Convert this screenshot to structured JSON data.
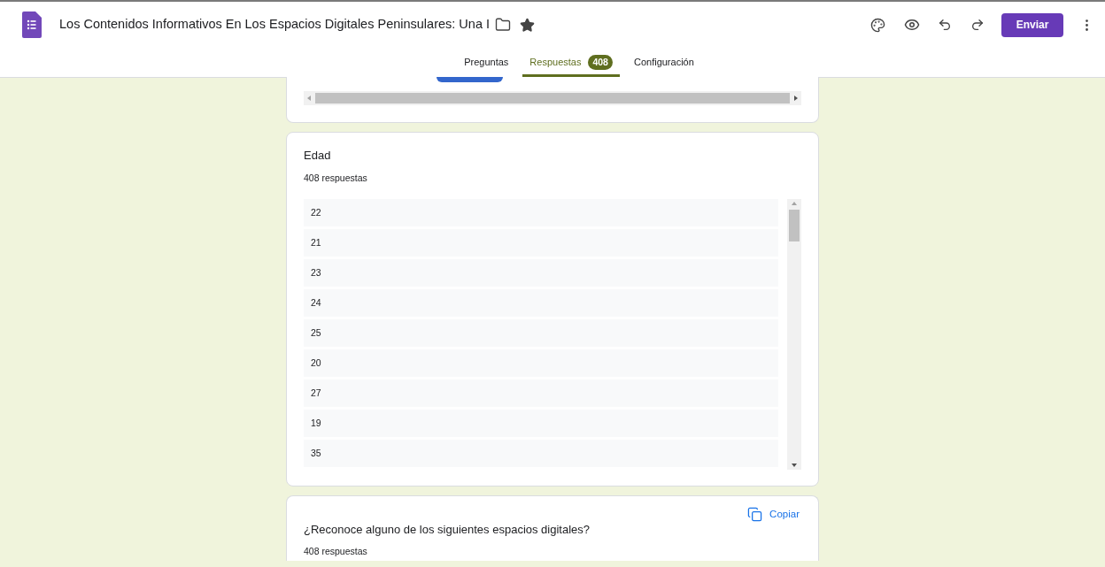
{
  "header": {
    "title": "Los Contenidos Informativos En Los Espacios Digitales Peninsulares: Una I",
    "send_button": "Enviar"
  },
  "tabs": [
    {
      "label": "Preguntas",
      "selected": false
    },
    {
      "label": "Respuestas",
      "selected": true,
      "badge": "408"
    },
    {
      "label": "Configuración",
      "selected": false
    }
  ],
  "cards": [
    {
      "kind": "list",
      "title": "Edad",
      "count": "408 respuestas",
      "responses": [
        "22",
        "21",
        "23",
        "24",
        "25",
        "20",
        "27",
        "19",
        "35"
      ]
    },
    {
      "kind": "chart",
      "title": "¿Reconoce alguno de los siguientes espacios digitales?",
      "count": "408 respuestas",
      "copy_button": "Copiar"
    }
  ]
}
